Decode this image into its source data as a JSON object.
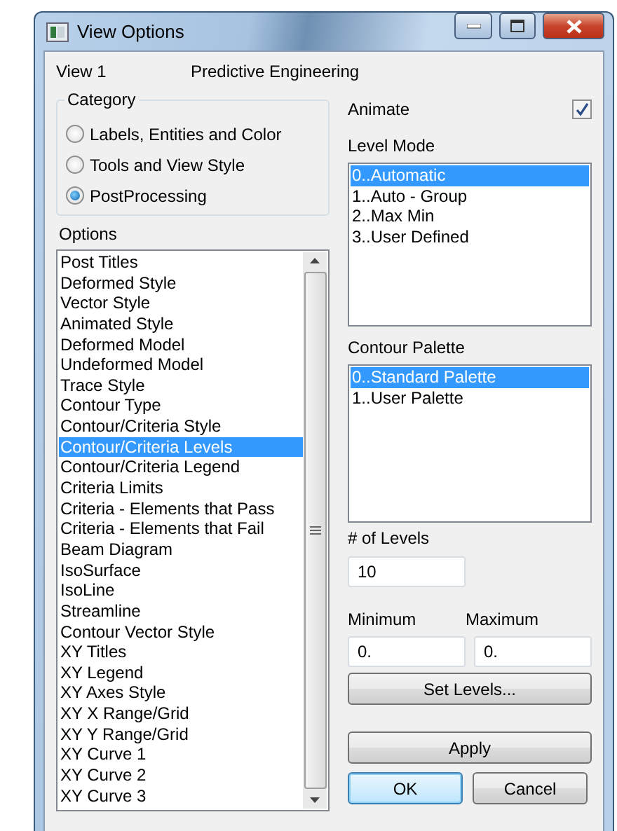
{
  "window": {
    "title": "View Options"
  },
  "view": {
    "label": "View  1",
    "name": "Predictive Engineering"
  },
  "category": {
    "title": "Category",
    "options": [
      {
        "label": "Labels, Entities and Color",
        "selected": false
      },
      {
        "label": "Tools and View Style",
        "selected": false
      },
      {
        "label": "PostProcessing",
        "selected": true
      }
    ]
  },
  "options": {
    "title": "Options",
    "items": [
      {
        "label": "Post Titles",
        "selected": false
      },
      {
        "label": "Deformed Style",
        "selected": false
      },
      {
        "label": "Vector Style",
        "selected": false
      },
      {
        "label": "Animated Style",
        "selected": false
      },
      {
        "label": "Deformed Model",
        "selected": false
      },
      {
        "label": "Undeformed Model",
        "selected": false
      },
      {
        "label": "Trace Style",
        "selected": false
      },
      {
        "label": "Contour Type",
        "selected": false
      },
      {
        "label": "Contour/Criteria Style",
        "selected": false
      },
      {
        "label": "Contour/Criteria Levels",
        "selected": true
      },
      {
        "label": "Contour/Criteria Legend",
        "selected": false
      },
      {
        "label": "Criteria Limits",
        "selected": false
      },
      {
        "label": "Criteria - Elements that Pass",
        "selected": false
      },
      {
        "label": "Criteria - Elements that Fail",
        "selected": false
      },
      {
        "label": "Beam Diagram",
        "selected": false
      },
      {
        "label": "IsoSurface",
        "selected": false
      },
      {
        "label": "IsoLine",
        "selected": false
      },
      {
        "label": "Streamline",
        "selected": false
      },
      {
        "label": "Contour Vector Style",
        "selected": false
      },
      {
        "label": "XY Titles",
        "selected": false
      },
      {
        "label": "XY Legend",
        "selected": false
      },
      {
        "label": "XY Axes Style",
        "selected": false
      },
      {
        "label": "XY X Range/Grid",
        "selected": false
      },
      {
        "label": "XY Y Range/Grid",
        "selected": false
      },
      {
        "label": "XY Curve 1",
        "selected": false
      },
      {
        "label": "XY Curve 2",
        "selected": false
      },
      {
        "label": "XY Curve 3",
        "selected": false
      }
    ]
  },
  "animate": {
    "label": "Animate",
    "checked": true
  },
  "level_mode": {
    "title": "Level Mode",
    "items": [
      {
        "label": "0..Automatic",
        "selected": true
      },
      {
        "label": "1..Auto - Group",
        "selected": false
      },
      {
        "label": "2..Max Min",
        "selected": false
      },
      {
        "label": "3..User Defined",
        "selected": false
      }
    ]
  },
  "contour_palette": {
    "title": "Contour Palette",
    "items": [
      {
        "label": "0..Standard Palette",
        "selected": true
      },
      {
        "label": "1..User Palette",
        "selected": false
      }
    ]
  },
  "levels": {
    "label": "# of Levels",
    "value": "10"
  },
  "minimum": {
    "label": "Minimum",
    "value": "0."
  },
  "maximum": {
    "label": "Maximum",
    "value": "0."
  },
  "buttons": {
    "set_levels": "Set Levels...",
    "apply": "Apply",
    "ok": "OK",
    "cancel": "Cancel"
  }
}
